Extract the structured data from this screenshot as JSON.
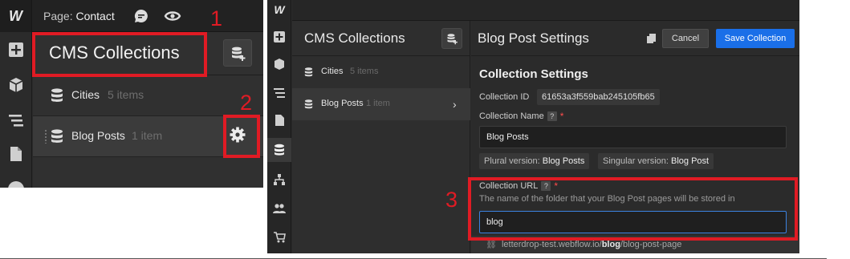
{
  "left": {
    "logo": "W",
    "page_prefix": "Page:",
    "page_name": "Contact",
    "panel_title": "CMS Collections",
    "collections": [
      {
        "label": "Cities",
        "count": "5 items"
      },
      {
        "label": "Blog Posts",
        "count": "1 item"
      }
    ]
  },
  "right": {
    "logo": "W",
    "cms_title": "CMS Collections",
    "collections": [
      {
        "label": "Cities",
        "count": "5 items"
      },
      {
        "label": "Blog Posts",
        "count": "1 item"
      }
    ],
    "settings_title": "Blog Post Settings",
    "cancel_label": "Cancel",
    "save_label": "Save Collection",
    "section_title": "Collection Settings",
    "collection_id_label": "Collection ID",
    "collection_id_value": "61653a3f559bab245105fb65",
    "collection_name_label": "Collection Name",
    "collection_name_value": "Blog Posts",
    "plural_label": "Plural version:",
    "plural_value": "Blog Posts",
    "singular_label": "Singular version:",
    "singular_value": "Blog Post",
    "collection_url_label": "Collection URL",
    "collection_url_hint": "The name of the folder that your Blog Post pages will be stored in",
    "collection_url_value": "blog",
    "url_prefix": "letterdrop-test.webflow.io/",
    "url_folder": "blog",
    "url_suffix": "/blog-post-page",
    "help_mark": "?",
    "required_mark": "*"
  },
  "annotations": {
    "n1": "1",
    "n2": "2",
    "n3": "3",
    "color": "#e01b24"
  }
}
